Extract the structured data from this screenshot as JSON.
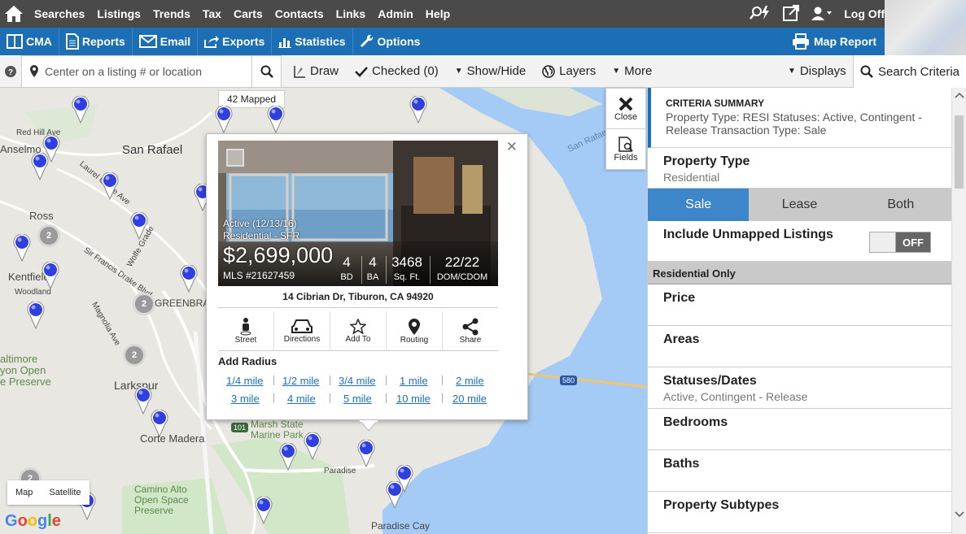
{
  "topnav": {
    "items": [
      "Searches",
      "Listings",
      "Trends",
      "Tax",
      "Carts",
      "Contacts",
      "Links",
      "Admin",
      "Help"
    ],
    "logoff": "Log Off"
  },
  "subnav": {
    "items": [
      "CMA",
      "Reports",
      "Email",
      "Exports",
      "Statistics",
      "Options"
    ],
    "map_report": "Map Report"
  },
  "toolbar": {
    "search_placeholder": "Center on a listing # or location",
    "draw": "Draw",
    "checked": "Checked (0)",
    "showhide": "Show/Hide",
    "layers": "Layers",
    "more": "More",
    "displays": "Displays",
    "search_criteria": "Search Criteria"
  },
  "map": {
    "mapped": "42 Mapped",
    "labels": [
      "San Rafael",
      "Red Hill Ave",
      "Anselmo",
      "Ross",
      "Kentfield",
      "Woodland",
      "Laurel Grove Ave",
      "Sir Francis Drake Blvd",
      "Wolfe Grade",
      "Magnolia Ave",
      "GREENBRAE",
      "Larkspur",
      "altimore",
      "yon Open",
      "e Preserve",
      "Corte Madera",
      "Marsh State",
      "Marine Park",
      "Paradise",
      "Camino Alto",
      "Open Space",
      "Preserve",
      "Paradise Cay",
      "San Rafael Br",
      "101",
      "580"
    ],
    "clusters": [
      "2",
      "2",
      "2",
      "2"
    ],
    "type_map": "Map",
    "type_satellite": "Satellite",
    "google": "Google",
    "colors": {
      "pin": "#2f3fe0",
      "water": "#a3cbf5",
      "land": "#e9e7e2"
    }
  },
  "popup": {
    "status": "Active  (12/13/16)",
    "ptype": "Residential - SFR",
    "price": "$2,699,000",
    "mls": "MLS #21627459",
    "beds": "4",
    "beds_label": "BD",
    "baths": "4",
    "baths_label": "BA",
    "sqft": "3468",
    "sqft_label": "Sq. Ft.",
    "dom": "22/22",
    "dom_label": "DOM/CDOM",
    "address": "14 Cibrian Dr, Tiburon, CA 94920",
    "actions": [
      "Street",
      "Directions",
      "Add To",
      "Routing",
      "Share"
    ],
    "radius_title": "Add Radius",
    "radius": [
      "1/4 mile",
      "1/2 mile",
      "3/4 mile",
      "1 mile",
      "2 mile",
      "3 mile",
      "4 mile",
      "5 mile",
      "10 mile",
      "20 mile"
    ]
  },
  "controls": {
    "close": "Close",
    "fields": "Fields"
  },
  "criteria": {
    "summary_title": "CRITERIA SUMMARY",
    "summary_text": "Property Type: RESI    Statuses: Active, Contingent - Release    Transaction Type: Sale",
    "property_type": "Property Type",
    "property_type_value": "Residential",
    "seg": [
      "Sale",
      "Lease",
      "Both"
    ],
    "unmapped": "Include Unmapped Listings",
    "toggle": "OFF",
    "residential_only": "Residential Only",
    "price": "Price",
    "areas": "Areas",
    "statuses": "Statuses/Dates",
    "statuses_value": "Active, Contingent - Release",
    "bedrooms": "Bedrooms",
    "baths": "Baths",
    "subtypes": "Property Subtypes"
  }
}
